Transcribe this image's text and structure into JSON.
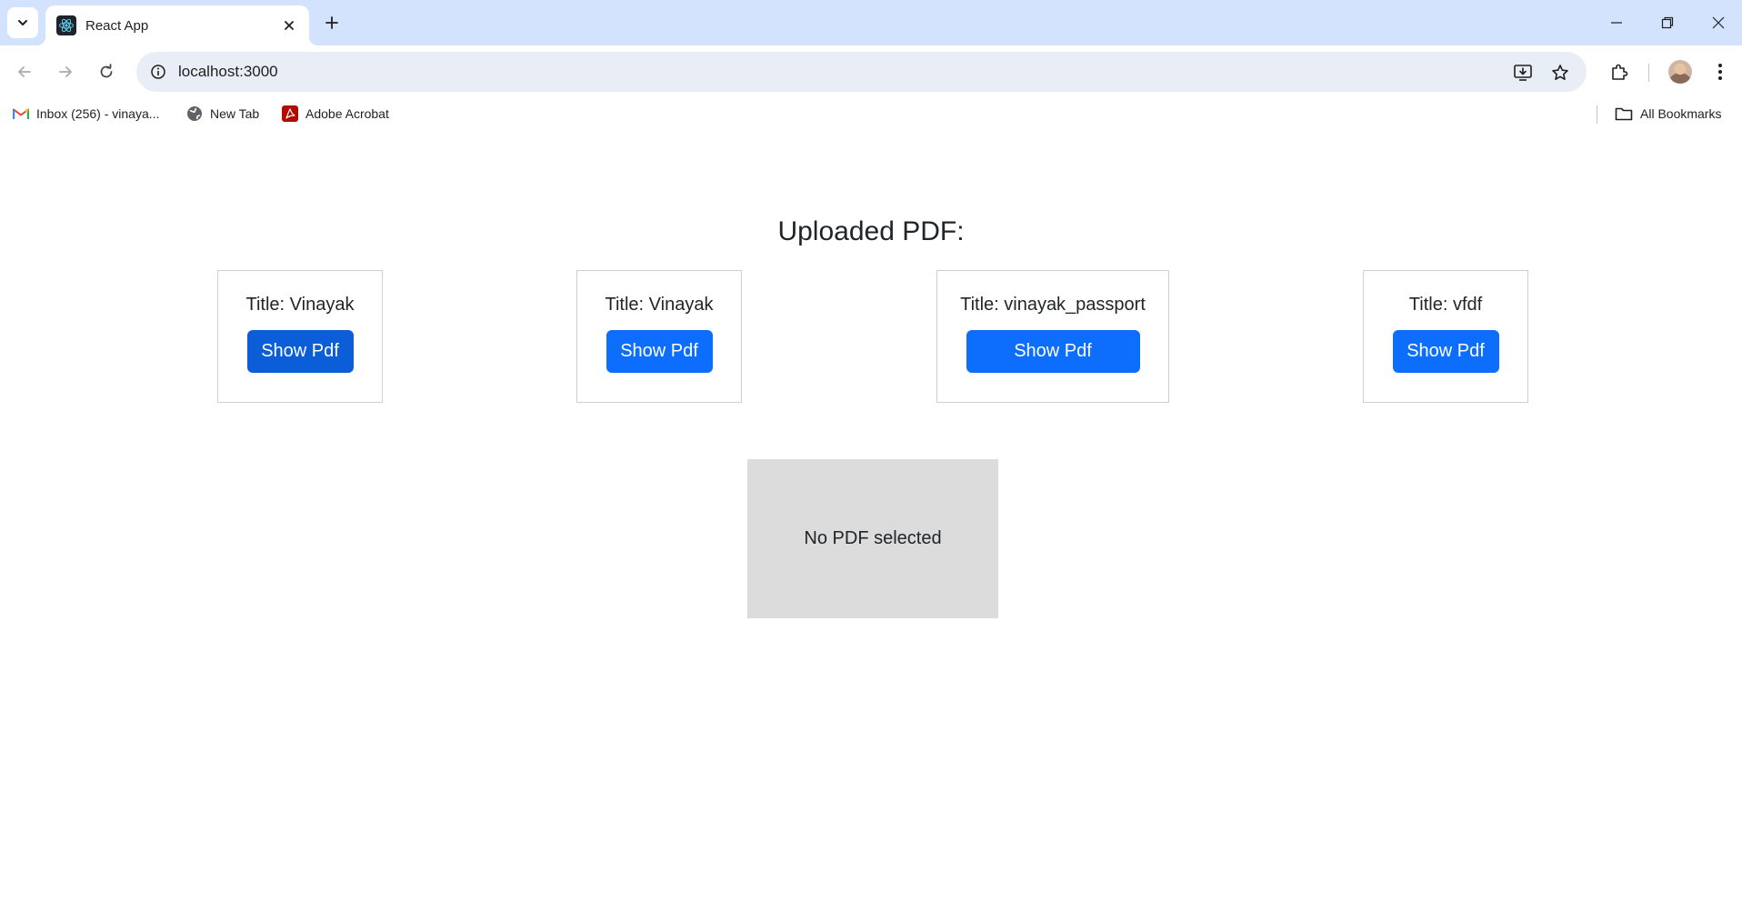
{
  "browser": {
    "tab": {
      "title": "React App"
    },
    "address": {
      "url": "localhost:3000"
    },
    "bookmarks": [
      {
        "label": "Inbox (256) - vinaya...",
        "icon": "gmail-icon"
      },
      {
        "label": "New Tab",
        "icon": "globe-icon"
      },
      {
        "label": "Adobe Acrobat",
        "icon": "acrobat-icon"
      }
    ],
    "all_bookmarks": "All Bookmarks"
  },
  "page": {
    "heading": "Uploaded PDF:",
    "cards": [
      {
        "title": "Title: Vinayak",
        "button": "Show Pdf"
      },
      {
        "title": "Title: Vinayak",
        "button": "Show Pdf"
      },
      {
        "title": "Title: vinayak_passport",
        "button": "Show Pdf"
      },
      {
        "title": "Title: vfdf",
        "button": "Show Pdf"
      }
    ],
    "viewer": {
      "message": "No PDF selected"
    }
  },
  "colors": {
    "primary": "#0d6efd",
    "primary_active": "#0b5ed7",
    "tabbar": "#d3e3fd",
    "viewer_bg": "#dcdcdc"
  }
}
